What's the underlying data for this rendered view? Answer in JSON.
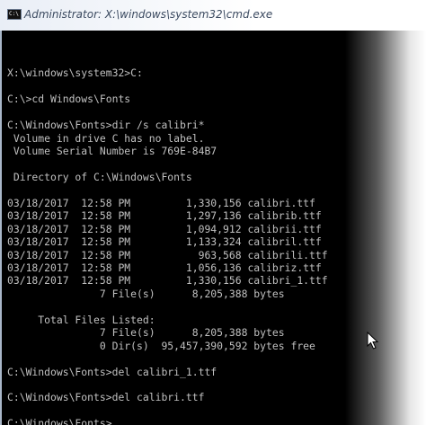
{
  "window": {
    "title": "Administrator: X:\\windows\\system32\\cmd.exe",
    "icon": "cmd-console-icon"
  },
  "console": {
    "lines": [
      "",
      "X:\\windows\\system32>C:",
      "",
      "C:\\>cd Windows\\Fonts",
      "",
      "C:\\Windows\\Fonts>dir /s calibri*",
      " Volume in drive C has no label.",
      " Volume Serial Number is 769E-84B7",
      "",
      " Directory of C:\\Windows\\Fonts",
      "",
      "03/18/2017  12:58 PM         1,330,156 calibri.ttf",
      "03/18/2017  12:58 PM         1,297,136 calibrib.ttf",
      "03/18/2017  12:58 PM         1,094,912 calibrii.ttf",
      "03/18/2017  12:58 PM         1,133,324 calibril.ttf",
      "03/18/2017  12:58 PM           963,568 calibrili.ttf",
      "03/18/2017  12:58 PM         1,056,136 calibriz.ttf",
      "03/18/2017  12:58 PM         1,330,156 calibri_1.ttf",
      "               7 File(s)      8,205,388 bytes",
      "",
      "     Total Files Listed:",
      "               7 File(s)      8,205,388 bytes",
      "               0 Dir(s)  95,457,390,592 bytes free",
      "",
      "C:\\Windows\\Fonts>del calibri_1.ttf",
      "",
      "C:\\Windows\\Fonts>del calibri.ttf",
      "",
      "C:\\Windows\\Fonts>"
    ]
  },
  "colors": {
    "console_background": "#000000",
    "console_text": "#c0c0c0",
    "titlebar_text": "#3b4a60"
  }
}
